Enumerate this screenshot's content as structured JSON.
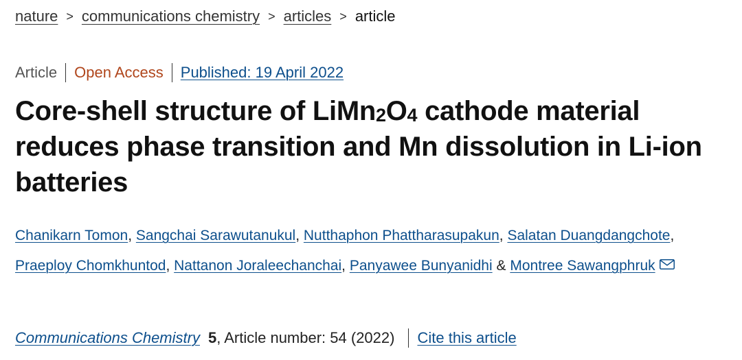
{
  "breadcrumb": {
    "items": [
      "nature",
      "communications chemistry",
      "articles"
    ],
    "current": "article",
    "separator": ">"
  },
  "meta": {
    "type": "Article",
    "access": "Open Access",
    "published": "Published: 19 April 2022"
  },
  "title": {
    "part1": "Core-shell structure of LiMn",
    "sub1": "2",
    "part2": "O",
    "sub2": "4",
    "part3": " cathode material reduces phase transition and Mn dissolution in Li-ion batteries"
  },
  "authors": {
    "list": [
      "Chanikarn Tomon",
      "Sangchai Sarawutanukul",
      "Nutthaphon Phattharasupakun",
      "Salatan Duangdangchote",
      "Praeploy Chomkhuntod",
      "Nattanon Joraleechanchai",
      "Panyawee Bunyanidhi"
    ],
    "separator": ", ",
    "conjunction": " & ",
    "last": "Montree Sawangphruk"
  },
  "citation": {
    "journal": "Communications Chemistry",
    "volume": "5",
    "article": ", Article number: 54 (2022)",
    "cite": "Cite this article"
  },
  "icons": {
    "mail": "mail-icon"
  },
  "colors": {
    "link": "#0d4f8c",
    "open_access": "#b0461c",
    "text": "#222222"
  }
}
